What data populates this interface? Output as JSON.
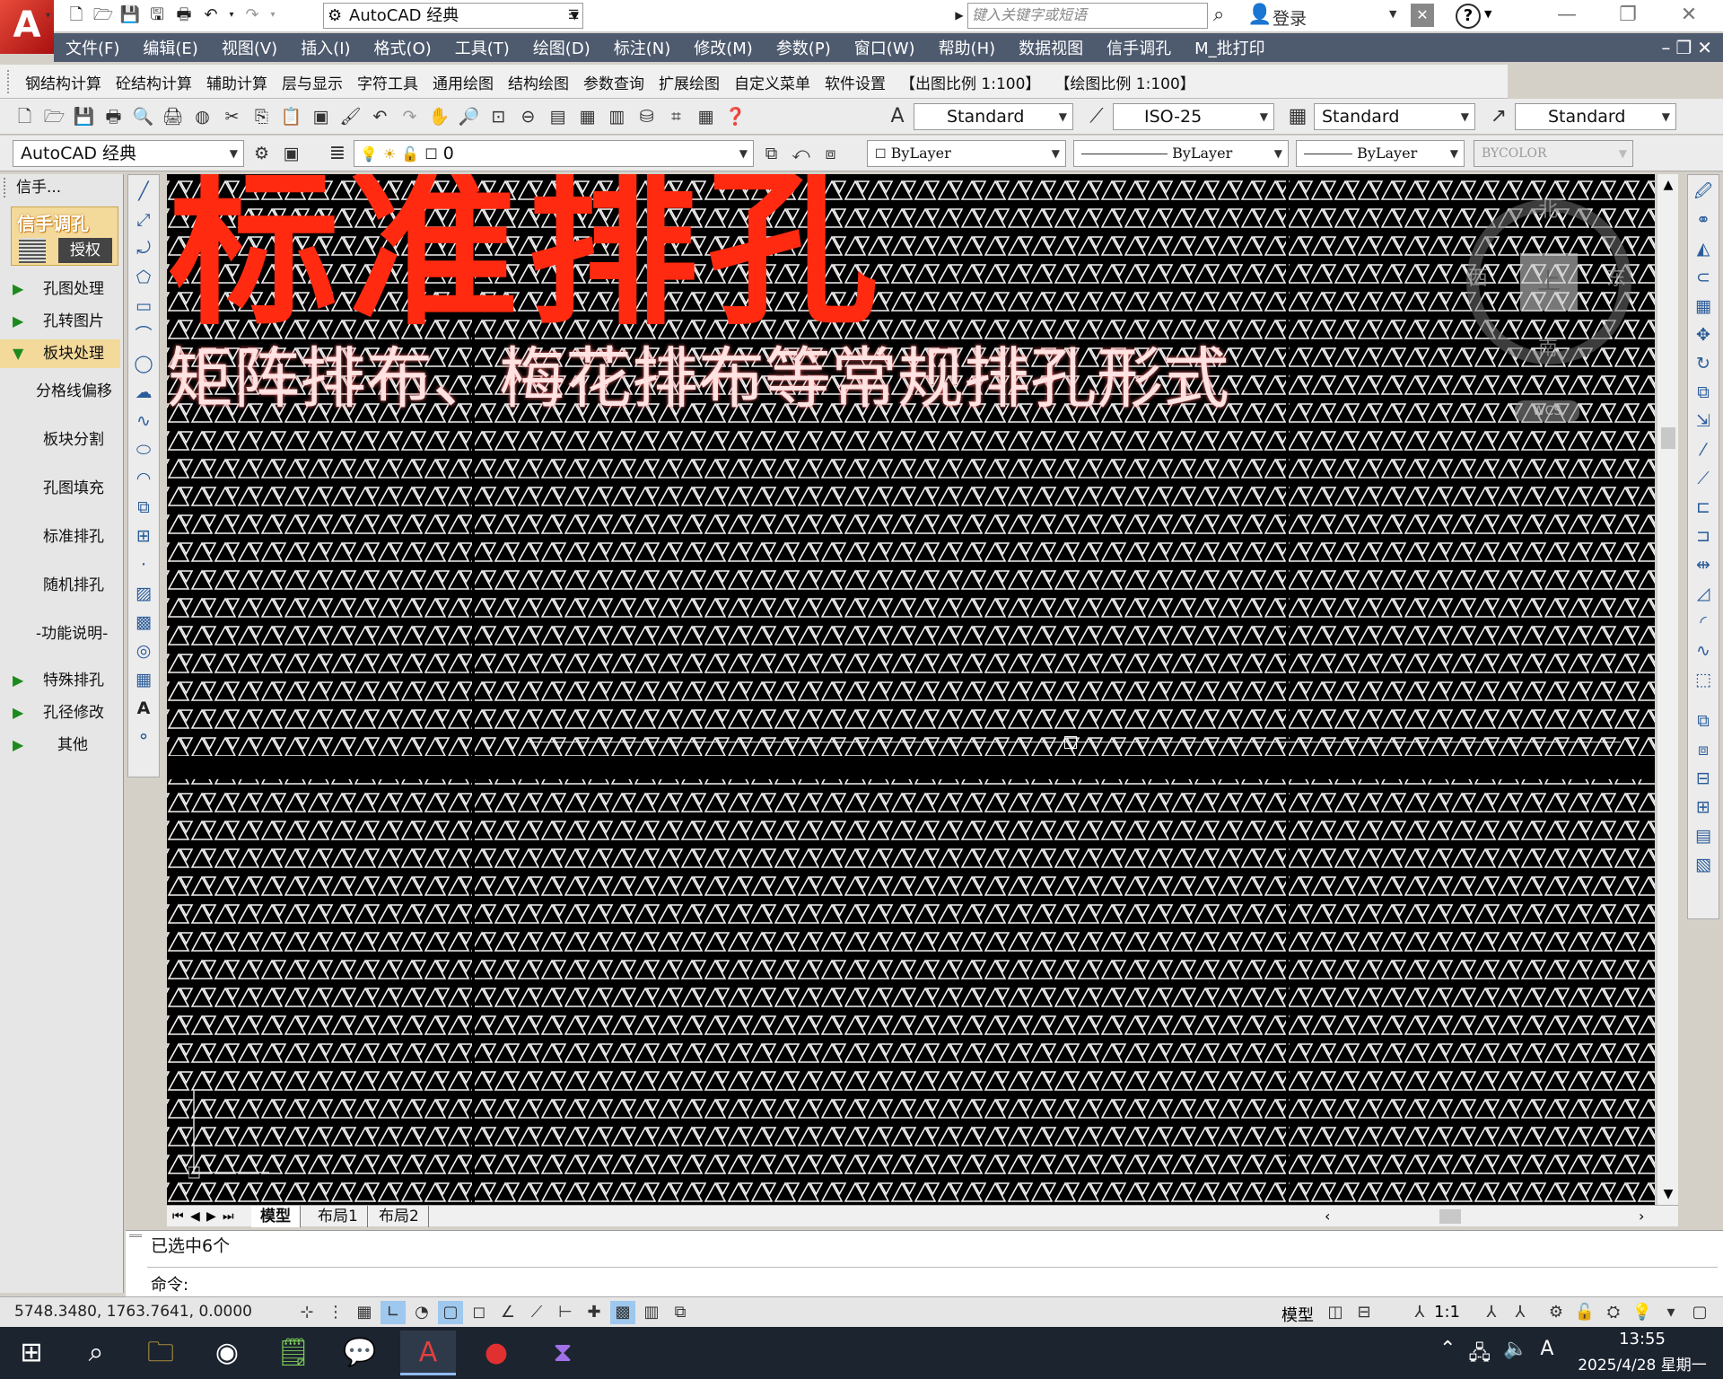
{
  "titlebar": {
    "workspace": "AutoCAD 经典",
    "search_placeholder": "键入关键字或短语",
    "login": "登录"
  },
  "menu": [
    "文件(F)",
    "编辑(E)",
    "视图(V)",
    "插入(I)",
    "格式(O)",
    "工具(T)",
    "绘图(D)",
    "标注(N)",
    "修改(M)",
    "参数(P)",
    "窗口(W)",
    "帮助(H)",
    "数据视图",
    "信手调孔",
    "M_批打印"
  ],
  "plugin_toolbar": [
    "钢结构计算",
    "砼结构计算",
    "辅助计算",
    "层与显示",
    "字符工具",
    "通用绘图",
    "结构绘图",
    "参数查询",
    "扩展绘图",
    "自定义菜单",
    "软件设置",
    "【出图比例 1:100】",
    "【绘图比例 1:100】"
  ],
  "styles": {
    "text_style": "Standard",
    "dim_style": "ISO-25",
    "table_style": "Standard",
    "multileader_style": "Standard"
  },
  "layers": {
    "workspace": "AutoCAD 经典",
    "current_layer": "0",
    "color": "ByLayer",
    "linetype": "ByLayer",
    "lineweight": "ByLayer",
    "plotstyle": "BYCOLOR"
  },
  "palette": {
    "title": "信手...",
    "brand": "信手调孔",
    "auth_label": "授权",
    "items": [
      {
        "label": "孔图处理",
        "type": "group",
        "expanded": false
      },
      {
        "label": "孔转图片",
        "type": "group",
        "expanded": false
      },
      {
        "label": "板块处理",
        "type": "group",
        "expanded": true
      },
      {
        "label": "分格线偏移",
        "type": "sub"
      },
      {
        "label": "板块分割",
        "type": "sub"
      },
      {
        "label": "孔图填充",
        "type": "sub"
      },
      {
        "label": "标准排孔",
        "type": "sub"
      },
      {
        "label": "随机排孔",
        "type": "sub"
      },
      {
        "label": "-功能说明-",
        "type": "sub"
      },
      {
        "label": "特殊排孔",
        "type": "group",
        "expanded": false
      },
      {
        "label": "孔径修改",
        "type": "group",
        "expanded": false
      },
      {
        "label": "其他",
        "type": "group",
        "expanded": false
      }
    ]
  },
  "overlay": {
    "title": "标准排孔",
    "subtitle": "矩阵排布、梅花排布等常规排孔形式",
    "title_color": "#ff2a10"
  },
  "viewcube": {
    "n": "北",
    "s": "南",
    "e": "东",
    "w": "西",
    "face": "上",
    "wcs": "WCS"
  },
  "tabs": [
    "模型",
    "布局1",
    "布局2"
  ],
  "command": {
    "history": "已选中6个",
    "prompt": "命令:"
  },
  "status": {
    "coords": "5748.3480,  1763.7641,  0.0000",
    "model": "模型",
    "anno_scale": "1:1"
  },
  "taskbar": {
    "time": "13:55",
    "date": "2025/4/28 星期一"
  }
}
